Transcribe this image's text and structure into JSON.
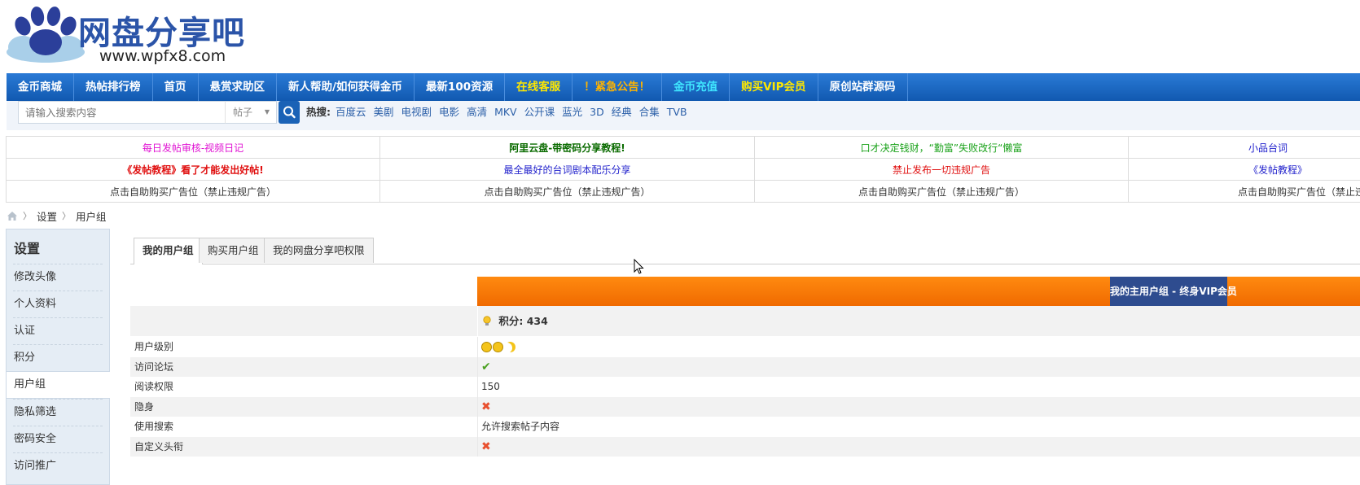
{
  "logo": {
    "title": "网盘分享吧",
    "url": "www.wpfx8.com",
    "paw_color": "#2b3f9a",
    "cloud_color": "#a9cfe9"
  },
  "nav": [
    {
      "label": "金币商城",
      "style": "white"
    },
    {
      "label": "热帖排行榜",
      "style": "white"
    },
    {
      "label": "首页",
      "style": "white"
    },
    {
      "label": "悬赏求助区",
      "style": "white"
    },
    {
      "label": "新人帮助/如何获得金币",
      "style": "white"
    },
    {
      "label": "最新100资源",
      "style": "white"
    },
    {
      "label": "在线客服",
      "style": "yellow"
    },
    {
      "label": "！紧急公告！",
      "style": "orange"
    },
    {
      "label": "金币充值",
      "style": "cyan"
    },
    {
      "label": "购买VIP会员",
      "style": "yellow"
    },
    {
      "label": "原创站群源码",
      "style": "white"
    }
  ],
  "search": {
    "placeholder": "请输入搜索内容",
    "type_label": "帖子",
    "hot_label": "热搜:",
    "hot_words": [
      "百度云",
      "美剧",
      "电视剧",
      "电影",
      "高清",
      "MKV",
      "公开课",
      "蓝光",
      "3D",
      "经典",
      "合集",
      "TVB"
    ]
  },
  "ads": [
    [
      {
        "text": "每日发帖审核-视频日记",
        "color": "#e013d3"
      },
      {
        "text": "阿里云盘-带密码分享教程!",
        "color": "#0a6b00",
        "bold": true
      },
      {
        "text": "口才决定钱财，“勤富”失败改行“懒富",
        "color": "#1aa21a"
      },
      {
        "text": "小品台词",
        "color": "#2020cc"
      }
    ],
    [
      {
        "text": "《发帖教程》看了才能发出好帖!",
        "color": "#e01010",
        "bold": true
      },
      {
        "text": "最全最好的台词剧本配乐分享",
        "color": "#2222cc"
      },
      {
        "text": "禁止发布一切违规广告",
        "color": "#e01010"
      },
      {
        "text": "《发帖教程》",
        "color": "#2222cc"
      }
    ],
    [
      {
        "text": "点击自助购买广告位（禁止违规广告）",
        "color": "#333333"
      },
      {
        "text": "点击自助购买广告位（禁止违规广告）",
        "color": "#333333"
      },
      {
        "text": "点击自助购买广告位（禁止违规广告）",
        "color": "#333333"
      },
      {
        "text": "点击自助购买广告位（禁止违规广告）",
        "color": "#333333"
      }
    ]
  ],
  "breadcrumb": [
    "设置",
    "用户组"
  ],
  "sidebar": {
    "title": "设置",
    "items": [
      "修改头像",
      "个人资料",
      "认证",
      "积分",
      "用户组",
      "隐私筛选",
      "密码安全",
      "访问推广"
    ],
    "active_index": 4
  },
  "tabs": [
    "我的用户组",
    "购买用户组",
    "我的网盘分享吧权限"
  ],
  "group": {
    "banner_label": "我的主用户组 - 终身VIP会员",
    "score_label": "积分: 434"
  },
  "rows": [
    {
      "label": "用户级别",
      "type": "level"
    },
    {
      "label": "访问论坛",
      "type": "check"
    },
    {
      "label": "阅读权限",
      "type": "text",
      "value": "150"
    },
    {
      "label": "隐身",
      "type": "cross"
    },
    {
      "label": "使用搜索",
      "type": "text",
      "value": "允许搜索帖子内容"
    },
    {
      "label": "自定义头衔",
      "type": "cross"
    }
  ],
  "colors": {
    "nav_bg": "#1a66c0",
    "banner_orange": "#f57a00",
    "banner_label_bg": "#2e4c8f"
  }
}
